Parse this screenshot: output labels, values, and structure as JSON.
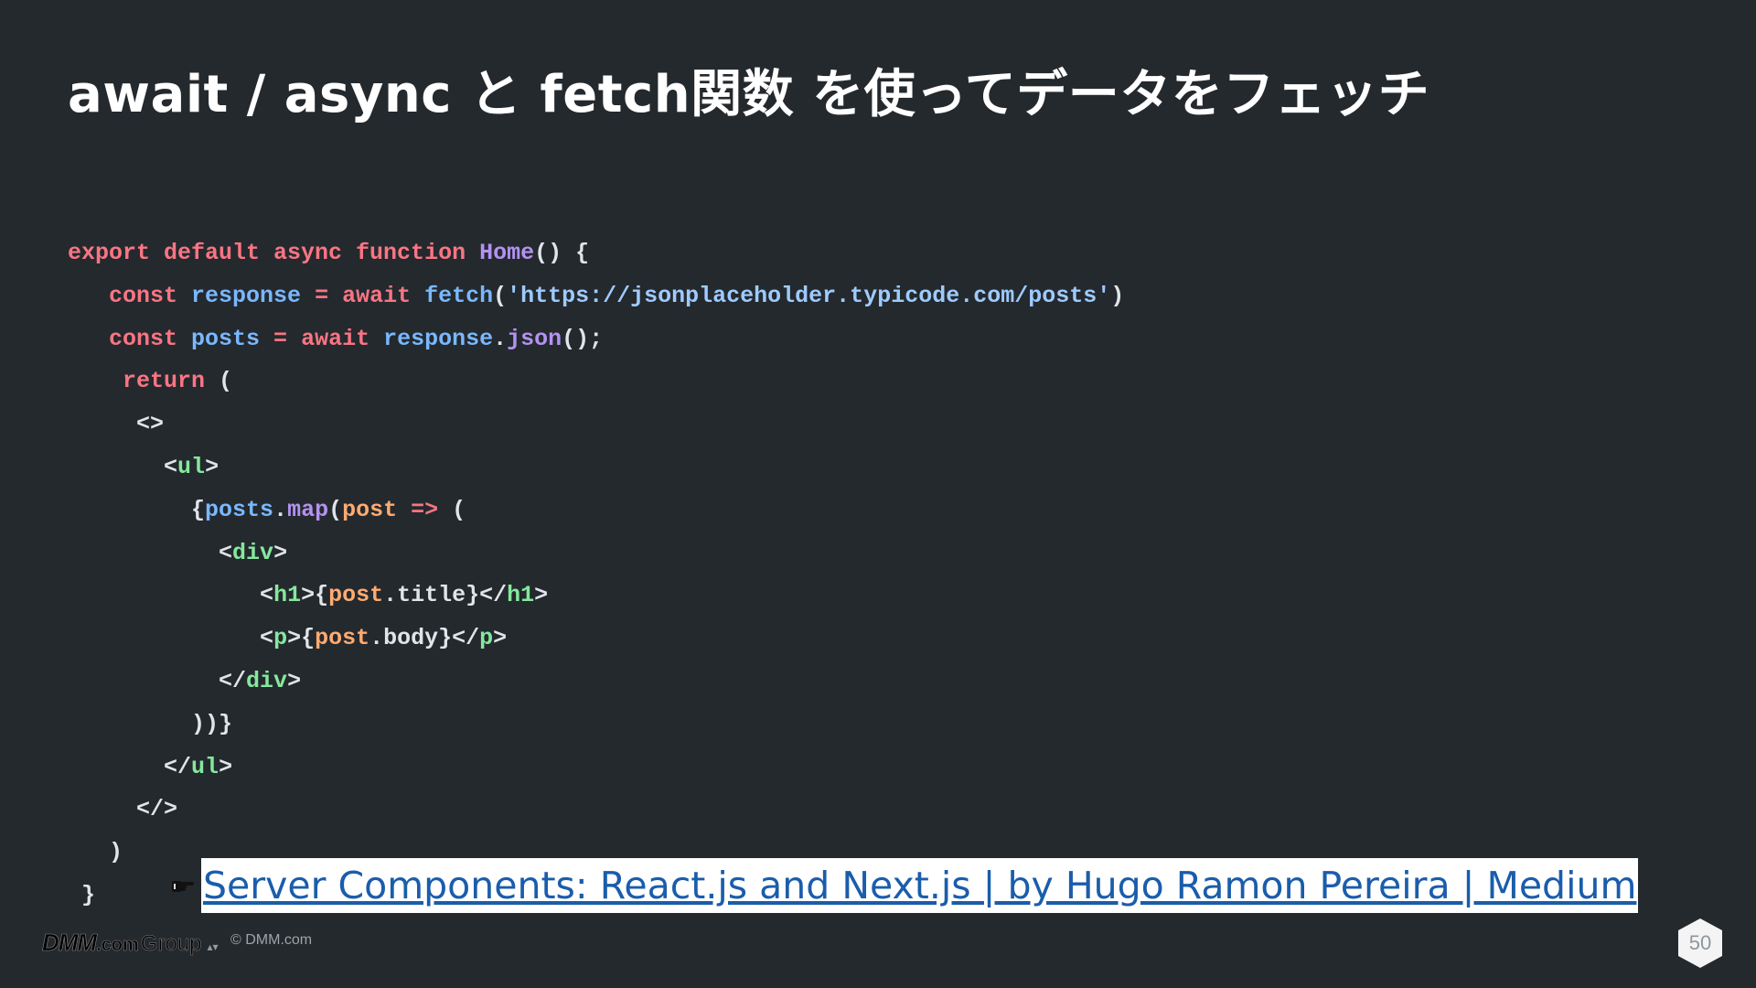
{
  "slide": {
    "title": "await / async と fetch関数 を使ってデータをフェッチ",
    "code_lines": [
      {
        "indent": "",
        "tokens": [
          {
            "t": "export default async function ",
            "c": "keyword"
          },
          {
            "t": "Home",
            "c": "func"
          },
          {
            "t": "() {",
            "c": "plain"
          }
        ]
      },
      {
        "indent": "   ",
        "tokens": [
          {
            "t": "const ",
            "c": "keyword"
          },
          {
            "t": "response",
            "c": "var"
          },
          {
            "t": " = ",
            "c": "keyword"
          },
          {
            "t": "await ",
            "c": "keyword"
          },
          {
            "t": "fetch",
            "c": "var"
          },
          {
            "t": "(",
            "c": "plain"
          },
          {
            "t": "'https://jsonplaceholder.typicode.com/posts'",
            "c": "string"
          },
          {
            "t": ")",
            "c": "plain"
          }
        ]
      },
      {
        "indent": "   ",
        "tokens": [
          {
            "t": "const ",
            "c": "keyword"
          },
          {
            "t": "posts",
            "c": "var"
          },
          {
            "t": " = ",
            "c": "keyword"
          },
          {
            "t": "await ",
            "c": "keyword"
          },
          {
            "t": "response",
            "c": "var"
          },
          {
            "t": ".",
            "c": "plain"
          },
          {
            "t": "json",
            "c": "func"
          },
          {
            "t": "();",
            "c": "plain"
          }
        ]
      },
      {
        "indent": "    ",
        "tokens": [
          {
            "t": "return",
            "c": "keyword"
          },
          {
            "t": " (",
            "c": "plain"
          }
        ]
      },
      {
        "indent": "     ",
        "tokens": [
          {
            "t": "<>",
            "c": "plain"
          }
        ]
      },
      {
        "indent": "       ",
        "tokens": [
          {
            "t": "<",
            "c": "plain"
          },
          {
            "t": "ul",
            "c": "tag"
          },
          {
            "t": ">",
            "c": "plain"
          }
        ]
      },
      {
        "indent": "         ",
        "tokens": [
          {
            "t": "{",
            "c": "plain"
          },
          {
            "t": "posts",
            "c": "var"
          },
          {
            "t": ".",
            "c": "plain"
          },
          {
            "t": "map",
            "c": "func"
          },
          {
            "t": "(",
            "c": "plain"
          },
          {
            "t": "post",
            "c": "param"
          },
          {
            "t": " => ",
            "c": "keyword"
          },
          {
            "t": "(",
            "c": "plain"
          }
        ]
      },
      {
        "indent": "           ",
        "tokens": [
          {
            "t": "<",
            "c": "plain"
          },
          {
            "t": "div",
            "c": "tag"
          },
          {
            "t": ">",
            "c": "plain"
          }
        ]
      },
      {
        "indent": "              ",
        "tokens": [
          {
            "t": "<",
            "c": "plain"
          },
          {
            "t": "h1",
            "c": "tag"
          },
          {
            "t": ">{",
            "c": "plain"
          },
          {
            "t": "post",
            "c": "param"
          },
          {
            "t": ".title}</",
            "c": "plain"
          },
          {
            "t": "h1",
            "c": "tag"
          },
          {
            "t": ">",
            "c": "plain"
          }
        ]
      },
      {
        "indent": "              ",
        "tokens": [
          {
            "t": "<",
            "c": "plain"
          },
          {
            "t": "p",
            "c": "tag"
          },
          {
            "t": ">{",
            "c": "plain"
          },
          {
            "t": "post",
            "c": "param"
          },
          {
            "t": ".body}</",
            "c": "plain"
          },
          {
            "t": "p",
            "c": "tag"
          },
          {
            "t": ">",
            "c": "plain"
          }
        ]
      },
      {
        "indent": "           ",
        "tokens": [
          {
            "t": "</",
            "c": "plain"
          },
          {
            "t": "div",
            "c": "tag"
          },
          {
            "t": ">",
            "c": "plain"
          }
        ]
      },
      {
        "indent": "         ",
        "tokens": [
          {
            "t": "))}",
            "c": "plain"
          }
        ]
      },
      {
        "indent": "       ",
        "tokens": [
          {
            "t": "</",
            "c": "plain"
          },
          {
            "t": "ul",
            "c": "tag"
          },
          {
            "t": ">",
            "c": "plain"
          }
        ]
      },
      {
        "indent": "     ",
        "tokens": [
          {
            "t": "</>",
            "c": "plain"
          }
        ]
      },
      {
        "indent": "   ",
        "tokens": [
          {
            "t": ")",
            "c": "plain"
          }
        ]
      },
      {
        "indent": " ",
        "tokens": [
          {
            "t": "}",
            "c": "plain"
          }
        ]
      }
    ],
    "link": {
      "text": "Server Components: React.js and Next.js | by Hugo Ramon Pereira | Medium",
      "icon": "pointing-hand-icon"
    },
    "footer": {
      "logo_dmm": "DMM",
      "logo_com": ".com",
      "logo_group": "Group",
      "copyright": "© DMM.com",
      "page_number": "50"
    },
    "colors": {
      "background": "#24292e",
      "keyword": "#f97583",
      "function": "#b392f0",
      "variable": "#79b8ff",
      "string": "#9ecbff",
      "tag": "#85e89d",
      "param": "#ffab70",
      "plain": "#e1e4e8",
      "link": "#1a5dab"
    }
  }
}
